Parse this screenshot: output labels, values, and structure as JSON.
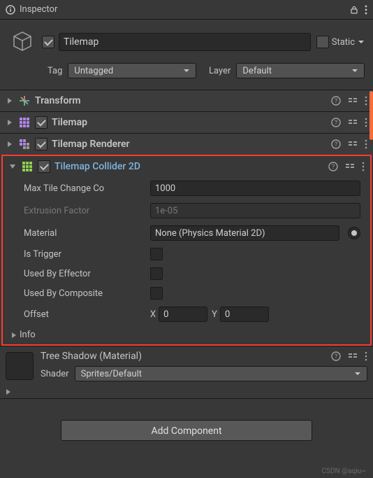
{
  "tab": {
    "title": "Inspector"
  },
  "object": {
    "name": "Tilemap",
    "static_label": "Static",
    "tag_label": "Tag",
    "tag_value": "Untagged",
    "layer_label": "Layer",
    "layer_value": "Default"
  },
  "components": {
    "transform": {
      "title": "Transform"
    },
    "tilemap": {
      "title": "Tilemap"
    },
    "renderer": {
      "title": "Tilemap Renderer"
    },
    "collider": {
      "title": "Tilemap Collider 2D",
      "props": {
        "max_tile_label": "Max Tile Change Co",
        "max_tile_value": "1000",
        "extrusion_label": "Extrusion Factor",
        "extrusion_value": "1e-05",
        "material_label": "Material",
        "material_value": "None (Physics Material 2D)",
        "is_trigger_label": "Is Trigger",
        "used_by_effector_label": "Used By Effector",
        "used_by_composite_label": "Used By Composite",
        "offset_label": "Offset",
        "offset_x_label": "X",
        "offset_x_value": "0",
        "offset_y_label": "Y",
        "offset_y_value": "0",
        "info_label": "Info"
      }
    }
  },
  "material": {
    "title": "Tree Shadow (Material)",
    "shader_label": "Shader",
    "shader_value": "Sprites/Default"
  },
  "footer": {
    "add_component": "Add Component",
    "watermark": "CSDN @aqiu~"
  }
}
